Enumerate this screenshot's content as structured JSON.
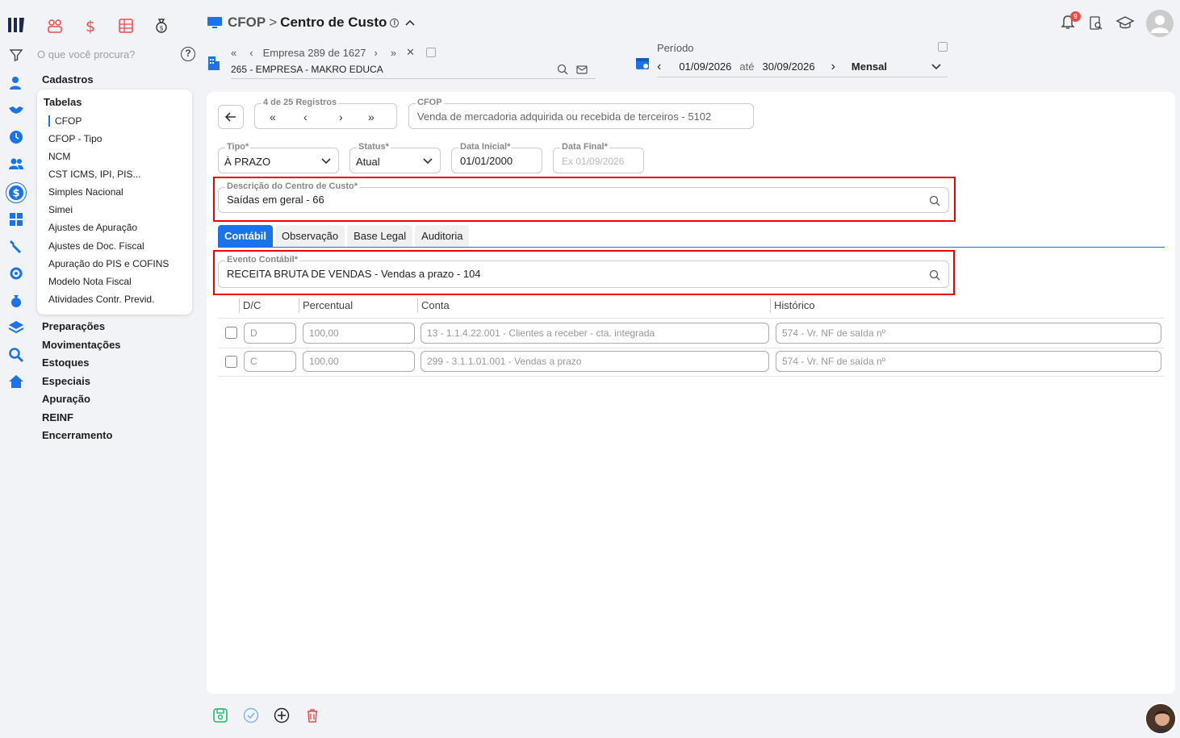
{
  "search": {
    "placeholder": "O que você procura?",
    "help": "?"
  },
  "menu": {
    "cadastros": "Cadastros",
    "tabelas": "Tabelas",
    "tabelas_items": [
      "CFOP",
      "CFOP - Tipo",
      "NCM",
      "CST ICMS, IPI, PIS...",
      "Simples Nacional",
      "Simei",
      "Ajustes de Apuração",
      "Ajustes de Doc. Fiscal",
      "Apuração do PIS e COFINS",
      "Modelo Nota Fiscal",
      "Atividades Contr. Previd."
    ],
    "sections": [
      "Preparações",
      "Movimentações",
      "Estoques",
      "Especiais",
      "Apuração",
      "REINF",
      "Encerramento"
    ]
  },
  "header": {
    "module": "CFOP",
    "separator": ">",
    "title": "Centro de Custo"
  },
  "empresa": {
    "nav_label": "Empresa 289 de 1627",
    "value": "265 - EMPRESA - MAKRO EDUCA"
  },
  "periodo": {
    "label": "Período",
    "start": "01/09/2026",
    "ate": "até",
    "end": "30/09/2026",
    "mode": "Mensal"
  },
  "notifications": {
    "count": "9"
  },
  "registros": {
    "label": "4 de 25 Registros"
  },
  "cfop": {
    "label": "CFOP",
    "value": "Venda de mercadoria adquirida ou recebida de terceiros - 5102"
  },
  "form": {
    "tipo_label": "Tipo*",
    "tipo_value": "À PRAZO",
    "status_label": "Status*",
    "status_value": "Atual",
    "data_inicial_label": "Data Inicial*",
    "data_inicial_value": "01/01/2000",
    "data_final_label": "Data Final*",
    "data_final_placeholder": "Ex 01/09/2026",
    "descricao_label": "Descrição do Centro de Custo*",
    "descricao_value": "Saídas em geral - 66"
  },
  "tabs": [
    "Contábil",
    "Observação",
    "Base Legal",
    "Auditoria"
  ],
  "evento": {
    "label": "Evento Contábil*",
    "value": "RECEITA BRUTA DE VENDAS - Vendas a prazo - 104"
  },
  "table": {
    "headers": [
      "D/C",
      "Percentual",
      "Conta",
      "Histórico"
    ],
    "rows": [
      {
        "dc": "D",
        "percentual": "100,00",
        "conta": "13 - 1.1.4.22.001 - Clientes a receber - cta. integrada",
        "historico": "574 - Vr. NF de saída nº"
      },
      {
        "dc": "C",
        "percentual": "100,00",
        "conta": "299 - 3.1.1.01.001 - Vendas a prazo",
        "historico": "574 - Vr. NF de saída nº"
      }
    ]
  },
  "colors": {
    "accent": "#1a73e8",
    "highlight": "#e00000",
    "module_red": "#e94b4b"
  }
}
